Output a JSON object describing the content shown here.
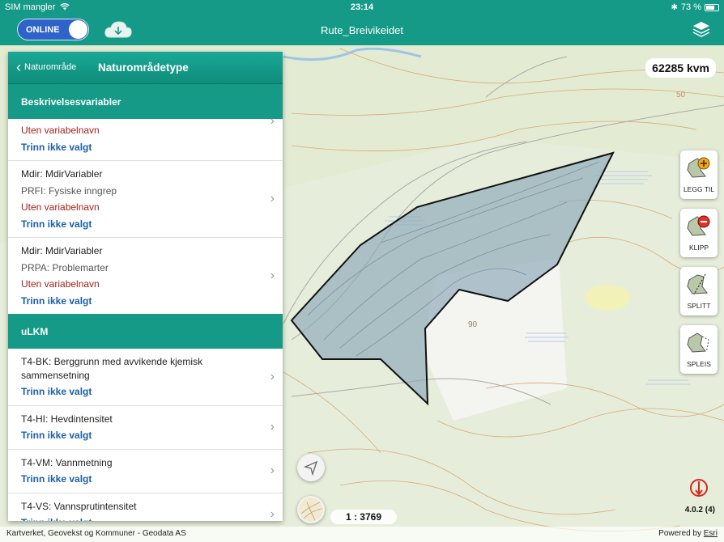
{
  "status_bar": {
    "carrier": "SIM mangler",
    "time": "23:14",
    "battery": "73 %",
    "battery_level": 0.73
  },
  "header": {
    "online_label": "ONLINE",
    "online": true,
    "title": "Rute_Breivikeidet",
    "brand_color": "#159a87"
  },
  "map": {
    "area_badge": "62285 kvm",
    "contour_label": "90",
    "contour_label_2": "50",
    "scale": "1 : 3769",
    "version": "4.0.2 (4)",
    "attribution": "Kartverket, Geovekst og Kommuner - Geodata AS",
    "powered_by": "Powered by",
    "esri": "Esri"
  },
  "panel": {
    "back_label": "Naturområde",
    "title": "Naturområdetype",
    "sections": [
      {
        "title": "Beskrivelsesvariabler"
      },
      {
        "title": "uLKM"
      }
    ],
    "rows_desc": [
      {
        "lines": [
          "Uten variabelnavn",
          "Trinn ikke valgt"
        ]
      },
      {
        "lines": [
          "Mdir: MdirVariabler",
          "PRFI: Fysiske inngrep",
          "Uten variabelnavn",
          "Trinn ikke valgt"
        ]
      },
      {
        "lines": [
          "Mdir: MdirVariabler",
          "PRPA: Problemarter",
          "Uten variabelnavn",
          "Trinn ikke valgt"
        ]
      }
    ],
    "rows_ulkm": [
      {
        "lines": [
          "T4-BK: Berggrunn med avvikende kjemisk sammensetning",
          "Trinn ikke valgt"
        ]
      },
      {
        "lines": [
          "T4-HI: Hevdintensitet",
          "Trinn ikke valgt"
        ]
      },
      {
        "lines": [
          "T4-VM: Vannmetning",
          "Trinn ikke valgt"
        ]
      },
      {
        "lines": [
          "T4-VS: Vannsprutintensitet",
          "Trinn ikke valgt"
        ]
      }
    ]
  },
  "tools": {
    "add": "LEGG TIL",
    "cut": "KLIPP",
    "split": "SPLITT",
    "merge": "SPLEIS"
  },
  "icons": [
    "wifi-icon",
    "bluetooth-icon",
    "battery-icon",
    "cloud-download-icon",
    "layers-icon",
    "chevron-left-icon",
    "chevron-right-icon",
    "polygon-add-icon",
    "polygon-cut-icon",
    "polygon-split-icon",
    "polygon-merge-icon",
    "locate-icon",
    "basemap-icon",
    "compass-icon"
  ]
}
